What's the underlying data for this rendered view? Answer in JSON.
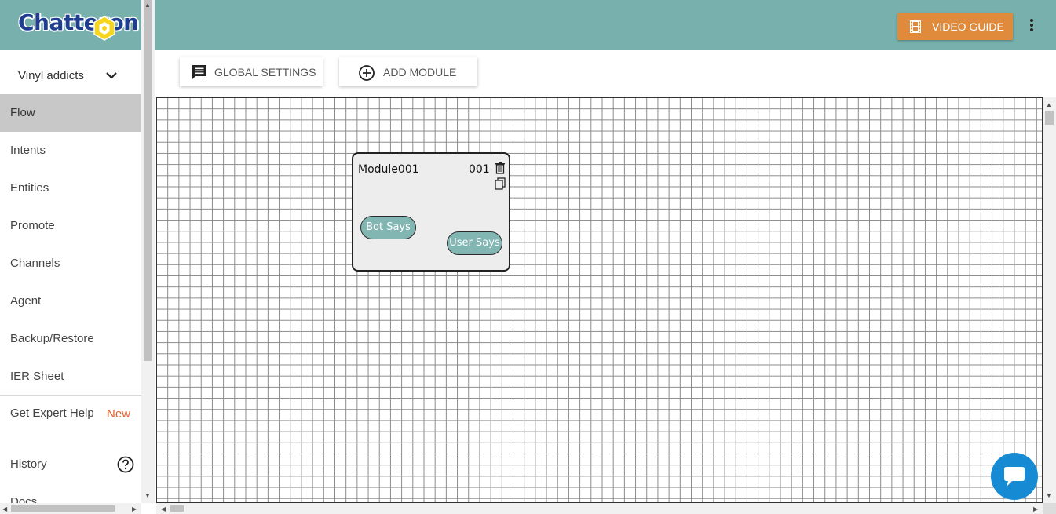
{
  "app": {
    "logo_text": "Chatteron"
  },
  "sidebar": {
    "project": "Vinyl addicts",
    "items": [
      {
        "label": "Flow",
        "active": true
      },
      {
        "label": "Intents"
      },
      {
        "label": "Entities"
      },
      {
        "label": "Promote"
      },
      {
        "label": "Channels"
      },
      {
        "label": "Agent"
      },
      {
        "label": "Backup/Restore"
      },
      {
        "label": "IER Sheet"
      }
    ],
    "expert_help": "Get Expert Help",
    "expert_badge": "New",
    "history": "History",
    "docs": "Docs"
  },
  "header": {
    "video_guide": "VIDEO GUIDE",
    "more_icon": "more-vert-icon",
    "color": "#77b0ac",
    "video_color": "#e08a3c"
  },
  "toolbar": {
    "global_settings": "GLOBAL SETTINGS",
    "add_module": "ADD MODULE"
  },
  "canvas": {
    "modules": [
      {
        "title": "Module001",
        "id": "001",
        "bot_says": "Bot Says",
        "user_says": "User Says"
      }
    ]
  },
  "chat_widget": {
    "icon": "chat-bubble-icon",
    "color": "#168bd4"
  }
}
